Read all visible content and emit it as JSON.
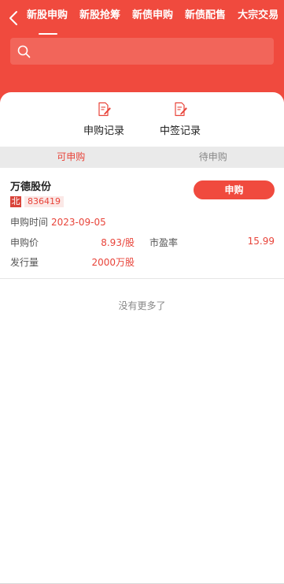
{
  "header": {
    "tabs": [
      {
        "label": "新股申购",
        "active": true
      },
      {
        "label": "新股抢筹",
        "active": false
      },
      {
        "label": "新债申购",
        "active": false
      },
      {
        "label": "新债配售",
        "active": false
      },
      {
        "label": "大宗交易",
        "active": false
      }
    ],
    "search": {
      "placeholder": ""
    }
  },
  "records": [
    {
      "label": "申购记录",
      "icon": "record-doc-icon"
    },
    {
      "label": "中签记录",
      "icon": "record-doc-icon"
    }
  ],
  "subtabs": [
    {
      "label": "可申购",
      "active": true
    },
    {
      "label": "待申购",
      "active": false
    }
  ],
  "stock": {
    "name": "万德股份",
    "market_badge": "北",
    "code": "836419",
    "buy_label": "申购",
    "date_label": "申购时间",
    "date_value": "2023-09-05",
    "price_label": "申购价",
    "price_value": "8.93/股",
    "pe_label": "市盈率",
    "pe_value": "15.99",
    "issue_label": "发行量",
    "issue_value": "2000万股"
  },
  "footer_text": "没有更多了",
  "colors": {
    "brand": "#f04a3e",
    "accent_text": "#e8443a"
  }
}
